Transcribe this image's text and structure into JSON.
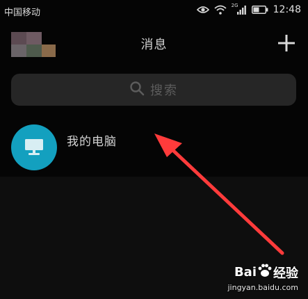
{
  "status_bar": {
    "carrier": "中国移动",
    "network_label": "2G",
    "time": "12:48"
  },
  "header": {
    "title": "消息"
  },
  "search": {
    "placeholder": "搜索"
  },
  "list": {
    "items": [
      {
        "title": "我的电脑",
        "icon": "monitor-icon"
      }
    ]
  },
  "watermark": {
    "logo_text_left": "Bai",
    "logo_text_right": "经验",
    "url": "jingyan.baidu.com"
  },
  "colors": {
    "background": "#050505",
    "search_background": "#262626",
    "avatar_accent": "#13a0bf",
    "annotation_arrow": "#ff3b3b"
  }
}
